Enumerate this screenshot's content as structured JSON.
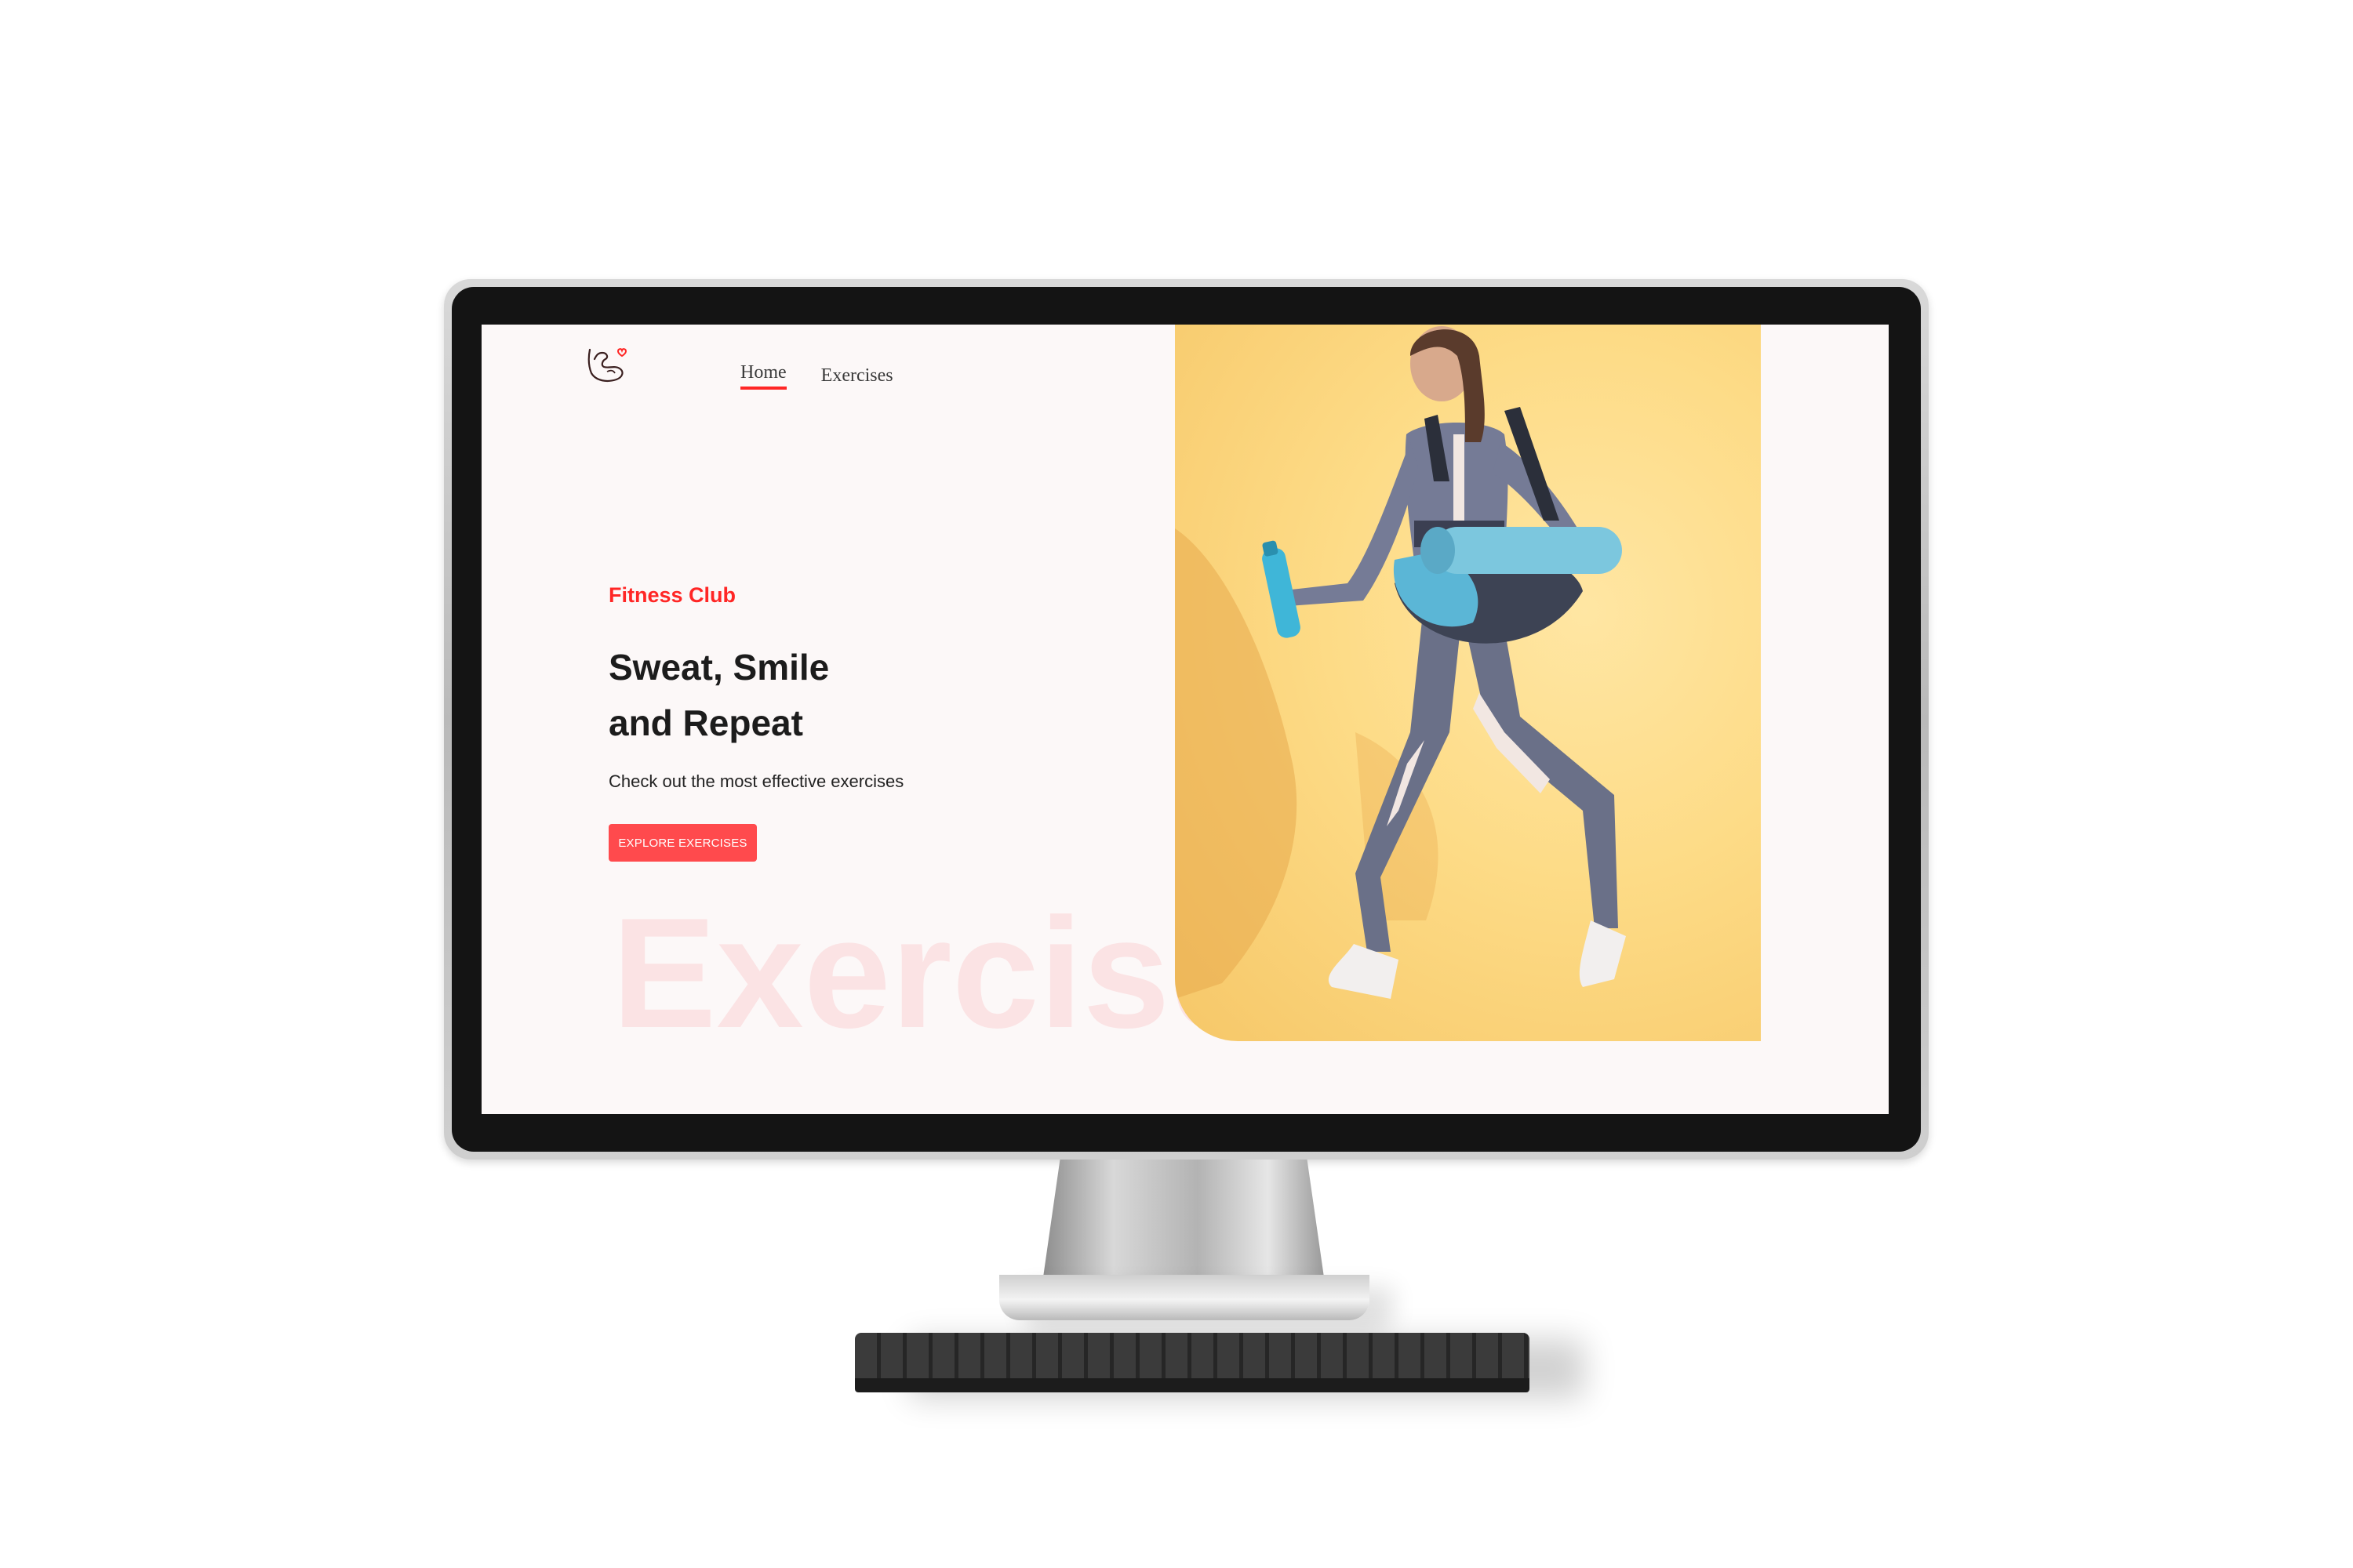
{
  "nav": {
    "items": [
      {
        "label": "Home",
        "active": true
      },
      {
        "label": "Exercises",
        "active": false
      }
    ]
  },
  "hero": {
    "subtitle": "Fitness Club",
    "headline_line1": "Sweat, Smile",
    "headline_line2": "and Repeat",
    "description": "Check out the most effective exercises",
    "cta_label": "EXPLORE EXERCISES",
    "watermark": "Exercises"
  },
  "icons": {
    "logo": "flexed-arm-heart-icon"
  },
  "colors": {
    "accent": "#ff2625",
    "button": "#ff4a4d",
    "hero_background": "#fddb86",
    "page_background": "#fcf8f8"
  }
}
